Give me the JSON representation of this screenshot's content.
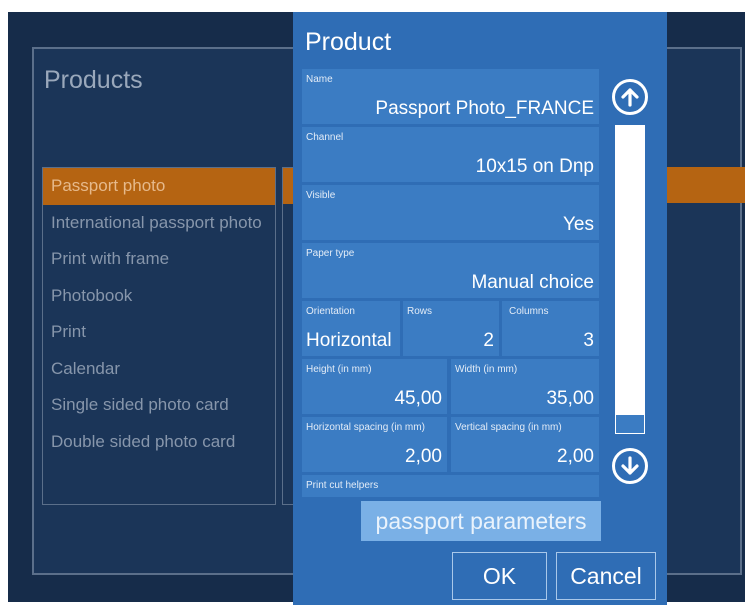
{
  "background": {
    "title": "Products",
    "items": [
      {
        "label": "Passport photo",
        "selected": true
      },
      {
        "label": "International passport photo",
        "selected": false
      },
      {
        "label": "Print with frame",
        "selected": false
      },
      {
        "label": "Photobook",
        "selected": false
      },
      {
        "label": "Print",
        "selected": false
      },
      {
        "label": "Calendar",
        "selected": false
      },
      {
        "label": "Single sided photo card",
        "selected": false
      },
      {
        "label": "Double sided photo card",
        "selected": false
      }
    ]
  },
  "dialog": {
    "title": "Product",
    "name": {
      "label": "Name",
      "value": "Passport Photo_FRANCE"
    },
    "channel": {
      "label": "Channel",
      "value": "10x15 on Dnp"
    },
    "visible": {
      "label": "Visible",
      "value": "Yes"
    },
    "paper_type": {
      "label": "Paper type",
      "value": "Manual choice"
    },
    "orientation": {
      "label": "Orientation",
      "value": "Horizontal"
    },
    "rows": {
      "label": "Rows",
      "value": "2"
    },
    "columns": {
      "label": "Columns",
      "value": "3"
    },
    "height": {
      "label": "Height (in mm)",
      "value": "45,00"
    },
    "width": {
      "label": "Width (in mm)",
      "value": "35,00"
    },
    "h_spacing": {
      "label": "Horizontal spacing (in mm)",
      "value": "2,00"
    },
    "v_spacing": {
      "label": "Vertical spacing (in mm)",
      "value": "2,00"
    },
    "print_cut": {
      "label": "Print cut helpers"
    },
    "passport_button": "passport parameters",
    "ok": "OK",
    "cancel": "Cancel"
  },
  "icons": {
    "scroll_up": "arrow-up-circle-icon",
    "scroll_down": "arrow-down-circle-icon"
  },
  "colors": {
    "dialog": "#2f6db5",
    "field": "#3b7cc3",
    "selection": "#b56412",
    "background": "#162c4a"
  }
}
